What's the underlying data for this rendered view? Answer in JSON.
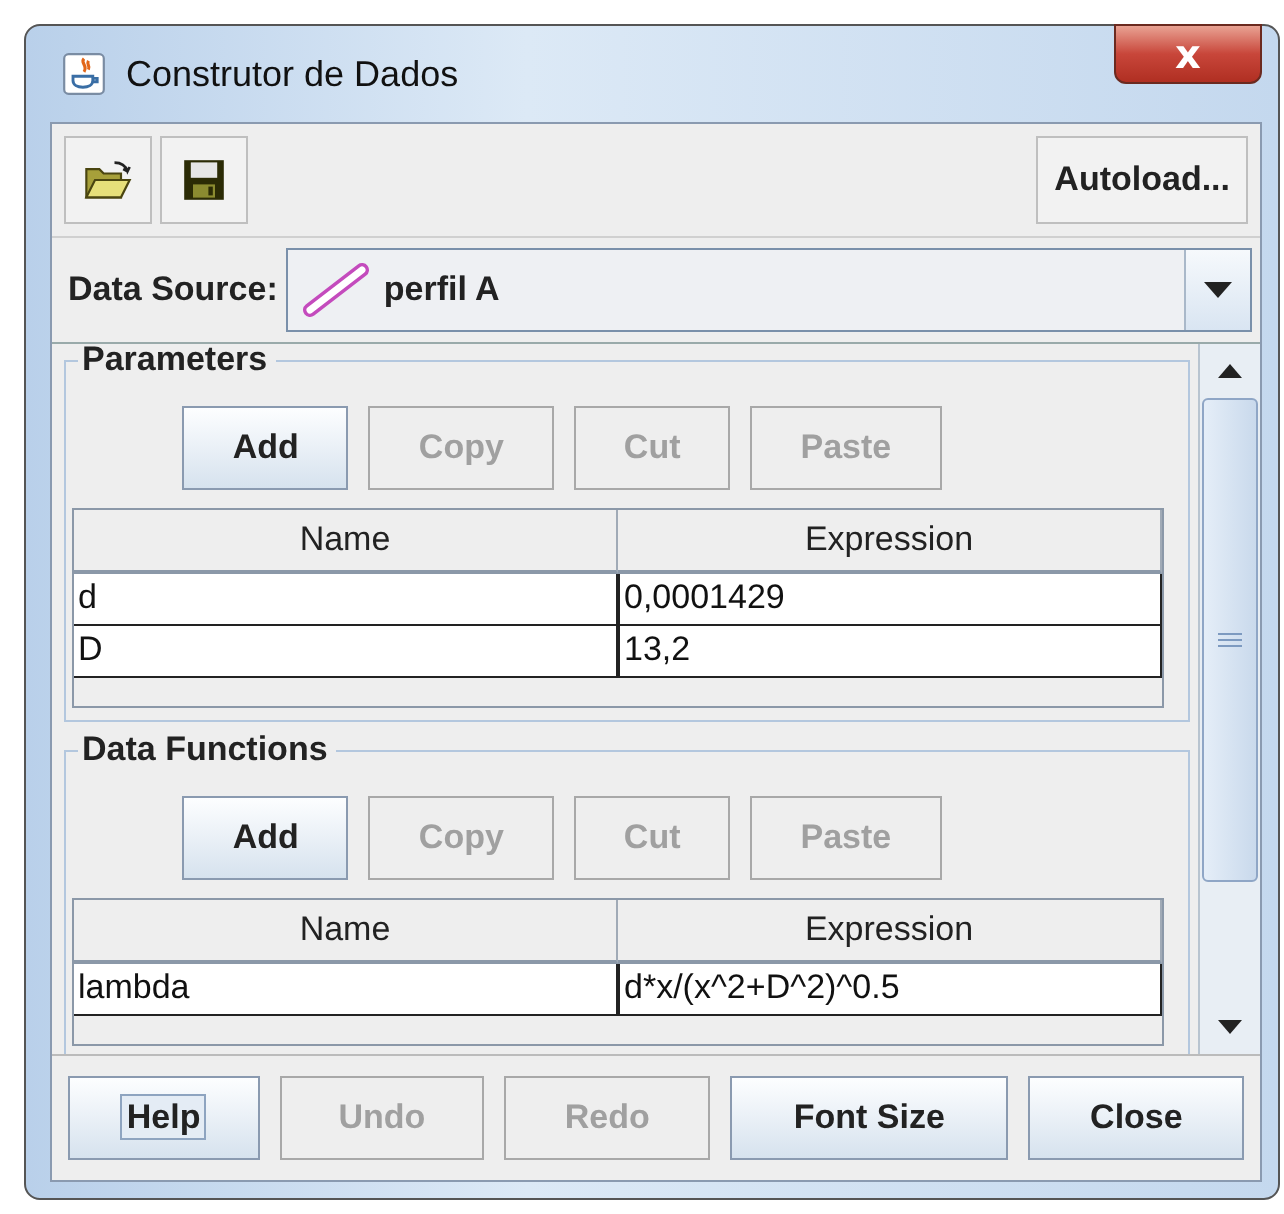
{
  "window": {
    "title": "Construtor de Dados",
    "close": "x"
  },
  "toolbar": {
    "autoload": "Autoload..."
  },
  "data_source": {
    "label": "Data Source:",
    "value": "perfil A"
  },
  "sections": [
    {
      "title": "Parameters",
      "buttons": [
        {
          "label": "Add",
          "disabled": false
        },
        {
          "label": "Copy",
          "disabled": true
        },
        {
          "label": "Cut",
          "disabled": true
        },
        {
          "label": "Paste",
          "disabled": true
        }
      ],
      "columns": [
        "Name",
        "Expression"
      ],
      "rows": [
        [
          "d",
          "0,0001429"
        ],
        [
          "D",
          "13,2"
        ]
      ]
    },
    {
      "title": "Data Functions",
      "buttons": [
        {
          "label": "Add",
          "disabled": false
        },
        {
          "label": "Copy",
          "disabled": true
        },
        {
          "label": "Cut",
          "disabled": true
        },
        {
          "label": "Paste",
          "disabled": true
        }
      ],
      "columns": [
        "Name",
        "Expression"
      ],
      "rows": [
        [
          "lambda",
          "d*x/(x^2+D^2)^0.5"
        ]
      ]
    }
  ],
  "footer": [
    {
      "label": "Help",
      "disabled": false,
      "focused": true
    },
    {
      "label": "Undo",
      "disabled": true,
      "focused": false
    },
    {
      "label": "Redo",
      "disabled": true,
      "focused": false
    },
    {
      "label": "Font Size",
      "disabled": false,
      "focused": false
    },
    {
      "label": "Close",
      "disabled": false,
      "focused": false
    }
  ]
}
